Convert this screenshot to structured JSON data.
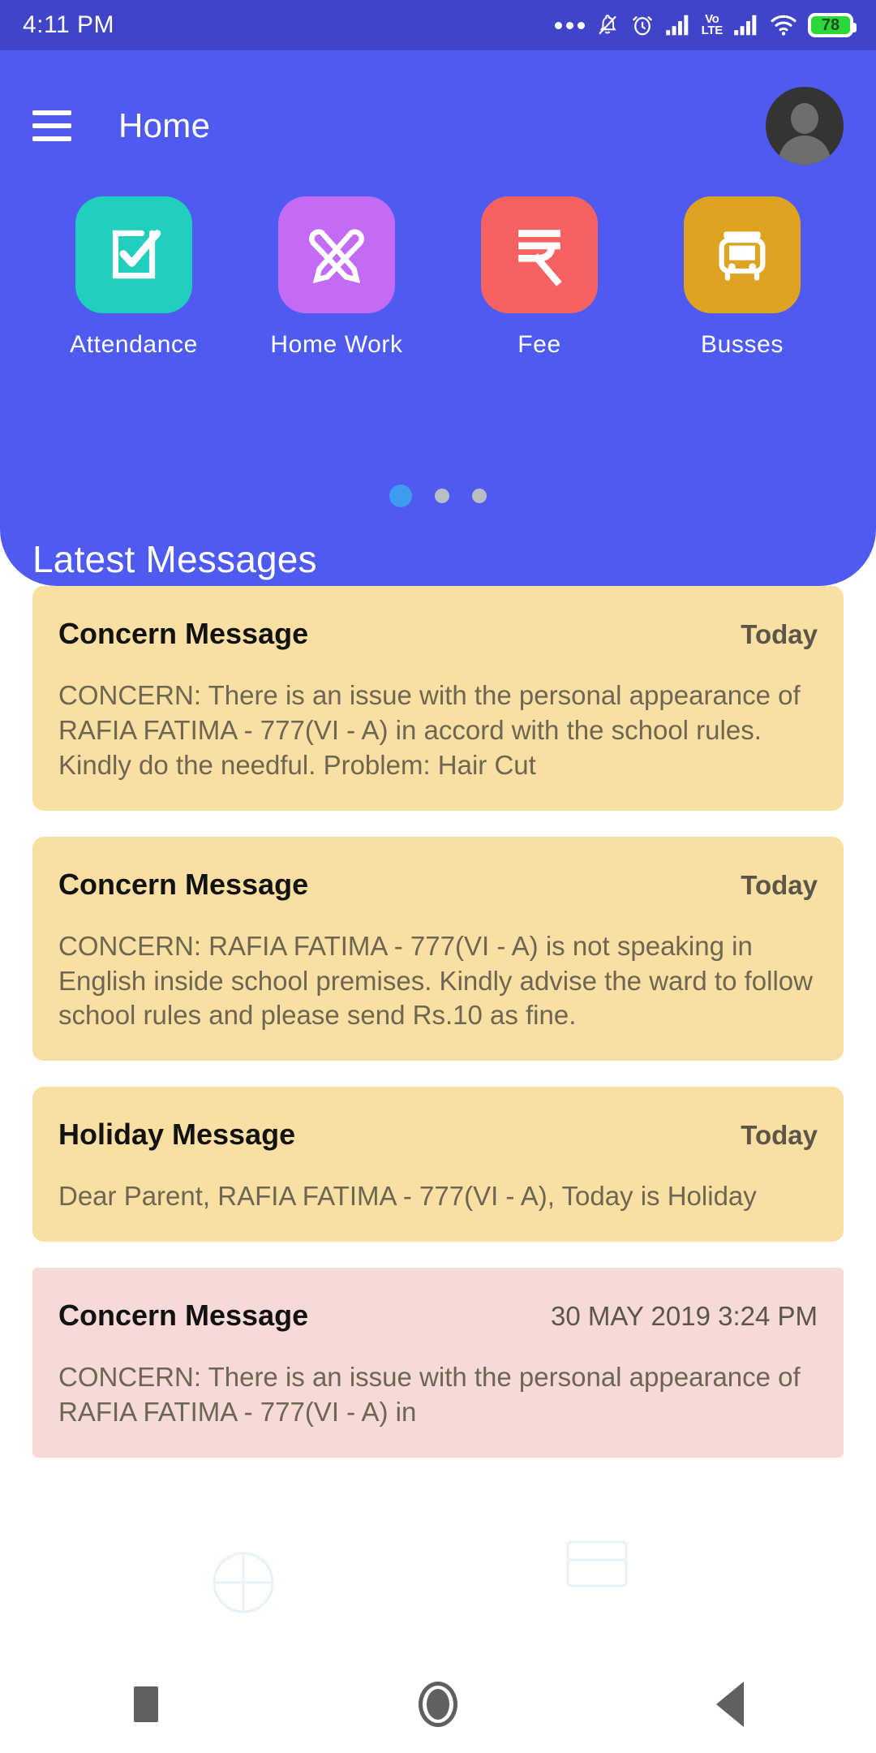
{
  "statusbar": {
    "time": "4:11 PM",
    "battery_percent": "78",
    "icons": [
      "more-dots-icon",
      "bell-muted-icon",
      "alarm-clock-icon",
      "signal-bars-icon",
      "volte-icon",
      "signal-bars-2-icon",
      "wifi-icon",
      "battery-icon"
    ],
    "volte_top": "Vo",
    "volte_bottom": "LTE"
  },
  "header": {
    "title": "Home",
    "menu_icon": "hamburger-menu-icon",
    "avatar_icon": "user-avatar-icon",
    "background_color": "#4f5bf0"
  },
  "tiles": [
    {
      "label": "Attendance",
      "icon": "checklist-icon",
      "color": "#21cfbe"
    },
    {
      "label": "Home Work",
      "icon": "pencil-icon",
      "color": "#c36bf5"
    },
    {
      "label": "Fee",
      "icon": "rupee-icon",
      "color": "#f66161"
    },
    {
      "label": "Busses",
      "icon": "bus-icon",
      "color": "#dfa322"
    }
  ],
  "carousel": {
    "total_dots": 3,
    "active_index": 0,
    "active_color": "#3d9bf0",
    "inactive_color": "#b9bec4"
  },
  "section": {
    "latest_messages_title": "Latest Messages"
  },
  "messages": [
    {
      "title": "Concern Message",
      "time": "Today",
      "body": "CONCERN: There is an issue with the personal appearance of RAFIA FATIMA - 777(VI - A) in accord with the school rules. Kindly do the needful. Problem: Hair Cut",
      "color": "#fadfa2"
    },
    {
      "title": "Concern Message",
      "time": "Today",
      "body": "CONCERN: RAFIA FATIMA - 777(VI - A) is not speaking in English inside school premises. Kindly advise the ward to follow school rules and please send Rs.10 as fine.",
      "color": "#fadfa2"
    },
    {
      "title": "Holiday Message",
      "time": "Today",
      "body": "Dear Parent, RAFIA FATIMA - 777(VI - A), Today is Holiday",
      "color": "#fadfa2"
    },
    {
      "title": "Concern Message",
      "time": "30 MAY 2019 3:24 PM",
      "body": "CONCERN: There is an issue with the personal appearance of RAFIA FATIMA - 777(VI - A) in",
      "color": "#f7dad7"
    }
  ],
  "navbar": {
    "recent_icon": "square-recents-icon",
    "home_icon": "circle-home-icon",
    "back_icon": "triangle-back-icon"
  }
}
